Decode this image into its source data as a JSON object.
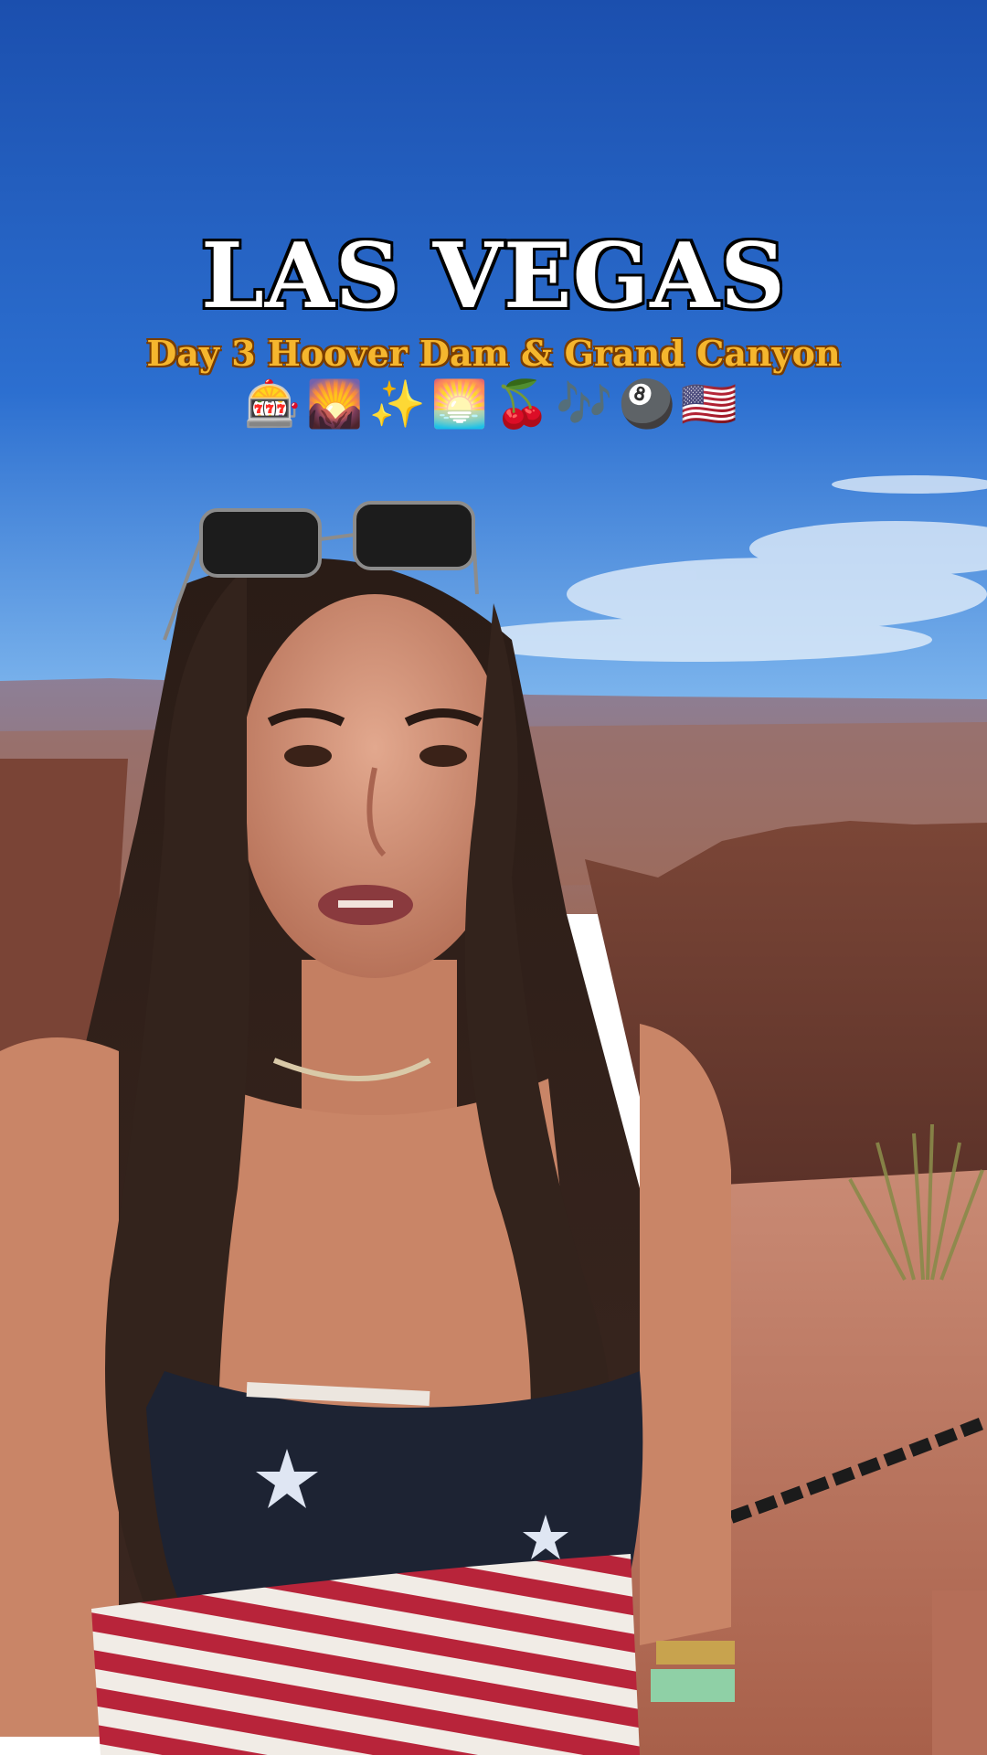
{
  "overlay": {
    "title": "LAS VEGAS",
    "subtitle": "Day 3 Hoover Dam & Grand Canyon",
    "emojis": "🎰🌄✨🌅🍒🎶🎱🇺🇸"
  },
  "scene": {
    "description_colors": {
      "sky_top": "#1c56b4",
      "sky_bottom": "#5aa2e6",
      "canyon": "#8a5a4a",
      "rock_ground": "#c9826b",
      "hair": "#2a1d17",
      "top_navy": "#1d2333",
      "stripe_red": "#b8243a",
      "stripe_white": "#f1ece6"
    }
  }
}
